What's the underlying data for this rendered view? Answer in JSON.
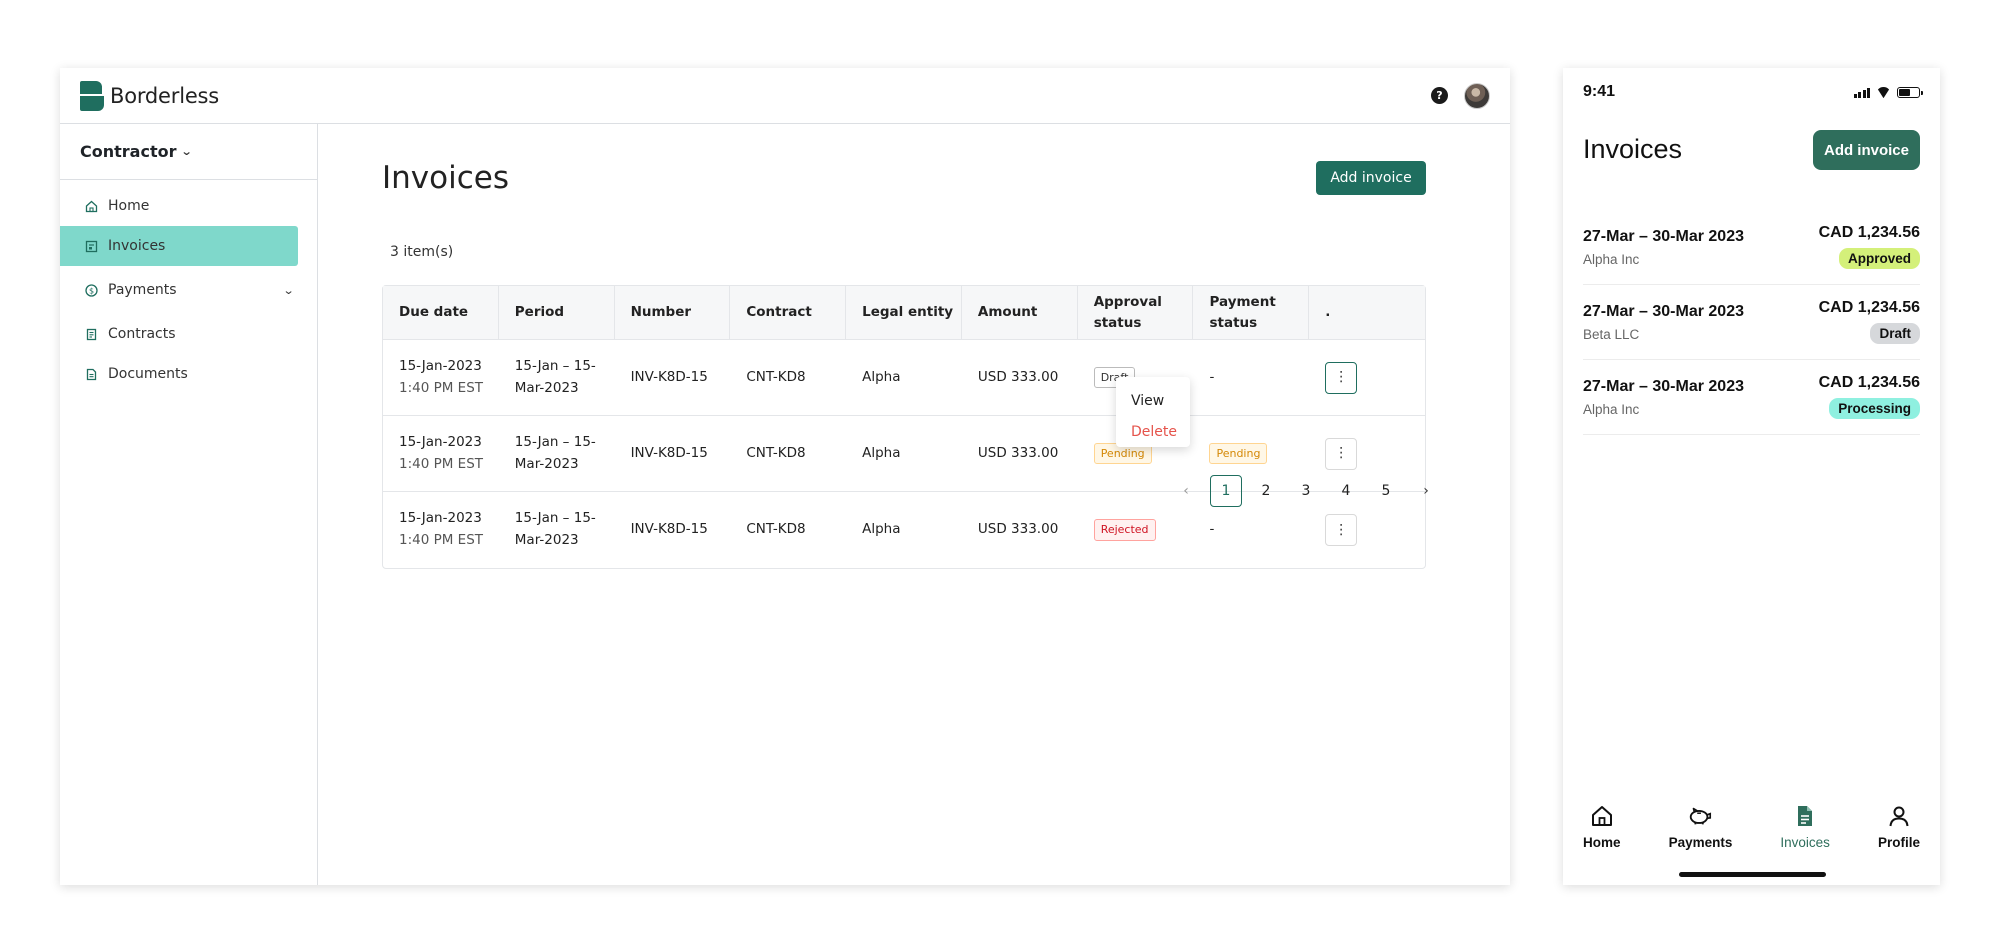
{
  "desktop": {
    "brand": "Borderless",
    "role": "Contractor",
    "nav": [
      {
        "label": "Home",
        "icon": "home-icon"
      },
      {
        "label": "Invoices",
        "icon": "invoice-icon"
      },
      {
        "label": "Payments",
        "icon": "dollar-circle-icon"
      },
      {
        "label": "Contracts",
        "icon": "contract-icon"
      },
      {
        "label": "Documents",
        "icon": "document-icon"
      }
    ],
    "title": "Invoices",
    "add_label": "Add invoice",
    "count": "3 item(s)",
    "columns": [
      "Due date",
      "Period",
      "Number",
      "Contract",
      "Legal entity",
      "Amount",
      "Approval status",
      "Payment status",
      "."
    ],
    "rows": [
      {
        "due_date": "15-Jan-2023",
        "due_time": "1:40 PM EST",
        "period_a": "15-Jan – 15-",
        "period_b": "Mar-2023",
        "number": "INV-K8D-15",
        "contract": "CNT-KD8",
        "entity": "Alpha",
        "amount": "USD 333.00",
        "approval": "Draft",
        "payment": "-"
      },
      {
        "due_date": "15-Jan-2023",
        "due_time": "1:40 PM EST",
        "period_a": "15-Jan – 15-",
        "period_b": "Mar-2023",
        "number": "INV-K8D-15",
        "contract": "CNT-KD8",
        "entity": "Alpha",
        "amount": "USD 333.00",
        "approval": "Pending",
        "payment": "Pending"
      },
      {
        "due_date": "15-Jan-2023",
        "due_time": "1:40 PM EST",
        "period_a": "15-Jan – 15-",
        "period_b": "Mar-2023",
        "number": "INV-K8D-15",
        "contract": "CNT-KD8",
        "entity": "Alpha",
        "amount": "USD 333.00",
        "approval": "Rejected",
        "payment": "-"
      }
    ],
    "row_menu": {
      "view": "View",
      "delete": "Delete"
    },
    "pagination": {
      "pages": [
        "1",
        "2",
        "3",
        "4",
        "5"
      ],
      "current": "1",
      "prev": "‹",
      "next": "›"
    }
  },
  "mobile": {
    "time": "9:41",
    "title": "Invoices",
    "add_label": "Add invoice",
    "items": [
      {
        "period": "27-Mar – 30-Mar 2023",
        "entity": "Alpha Inc",
        "amount": "CAD 1,234.56",
        "status": "Approved",
        "status_color": "#d4f07a"
      },
      {
        "period": "27-Mar – 30-Mar 2023",
        "entity": "Beta LLC",
        "amount": "CAD 1,234.56",
        "status": "Draft",
        "status_color": "#d6d8db"
      },
      {
        "period": "27-Mar – 30-Mar 2023",
        "entity": "Alpha Inc",
        "amount": "CAD 1,234.56",
        "status": "Processing",
        "status_color": "#8ff0e0"
      }
    ],
    "tabs": [
      {
        "label": "Home",
        "icon": "home-icon"
      },
      {
        "label": "Payments",
        "icon": "piggy-bank-icon"
      },
      {
        "label": "Invoices",
        "icon": "invoice-icon"
      },
      {
        "label": "Profile",
        "icon": "person-icon"
      }
    ],
    "active_tab": "Invoices"
  },
  "colors": {
    "brand": "#1f6e5f",
    "nav_active": "#7fd8cb",
    "danger": "#e5534b"
  }
}
